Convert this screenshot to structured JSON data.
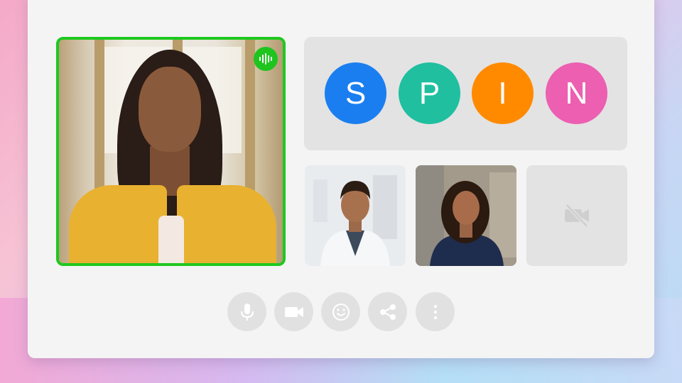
{
  "meeting": {
    "main_speaker": {
      "speaking_indicator_icon": "audio-waveform-icon",
      "highlight_color": "#1ec81e"
    },
    "avatars": [
      {
        "letter": "S",
        "color": "#1a7ef0"
      },
      {
        "letter": "P",
        "color": "#1fbfa0"
      },
      {
        "letter": "I",
        "color": "#ff8a00"
      },
      {
        "letter": "N",
        "color": "#ec5fb1"
      }
    ],
    "participants": [
      {
        "id": "man-in-lab-coat",
        "video": "on"
      },
      {
        "id": "woman-in-navy-top",
        "video": "on"
      },
      {
        "id": "camera-off-participant",
        "video": "off",
        "icon": "video-off-icon"
      }
    ]
  },
  "controls": [
    {
      "icon": "microphone-icon"
    },
    {
      "icon": "video-camera-icon"
    },
    {
      "icon": "emoji-icon"
    },
    {
      "icon": "share-icon"
    },
    {
      "icon": "more-vertical-icon"
    }
  ]
}
